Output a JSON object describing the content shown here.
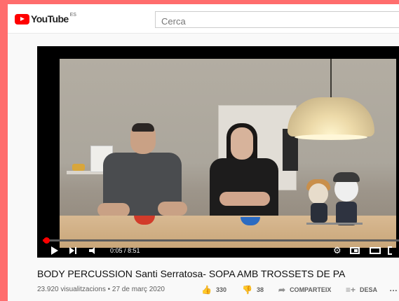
{
  "masthead": {
    "logo_text": "YouTube",
    "country_code": "ES",
    "search_placeholder": "Cerca"
  },
  "player": {
    "time_display": "0:05 / 8:51",
    "progress_fraction": 0.0094,
    "colors": {
      "progress": "#ff0000",
      "background": "#000000"
    }
  },
  "video": {
    "title": "BODY PERCUSSION Santi Serratosa- SOPA AMB TROSSETS DE PA",
    "meta": "23.920 visualitzacions • 27 de març 2020",
    "likes": "330",
    "dislikes": "38",
    "share_label": "COMPARTEIX",
    "save_label": "DESA",
    "more_label": "…"
  },
  "icons": {
    "like": "thumb-up-icon",
    "dislike": "thumb-down-icon",
    "share": "share-arrow-icon",
    "save": "playlist-add-icon",
    "settings": "gear-icon"
  }
}
